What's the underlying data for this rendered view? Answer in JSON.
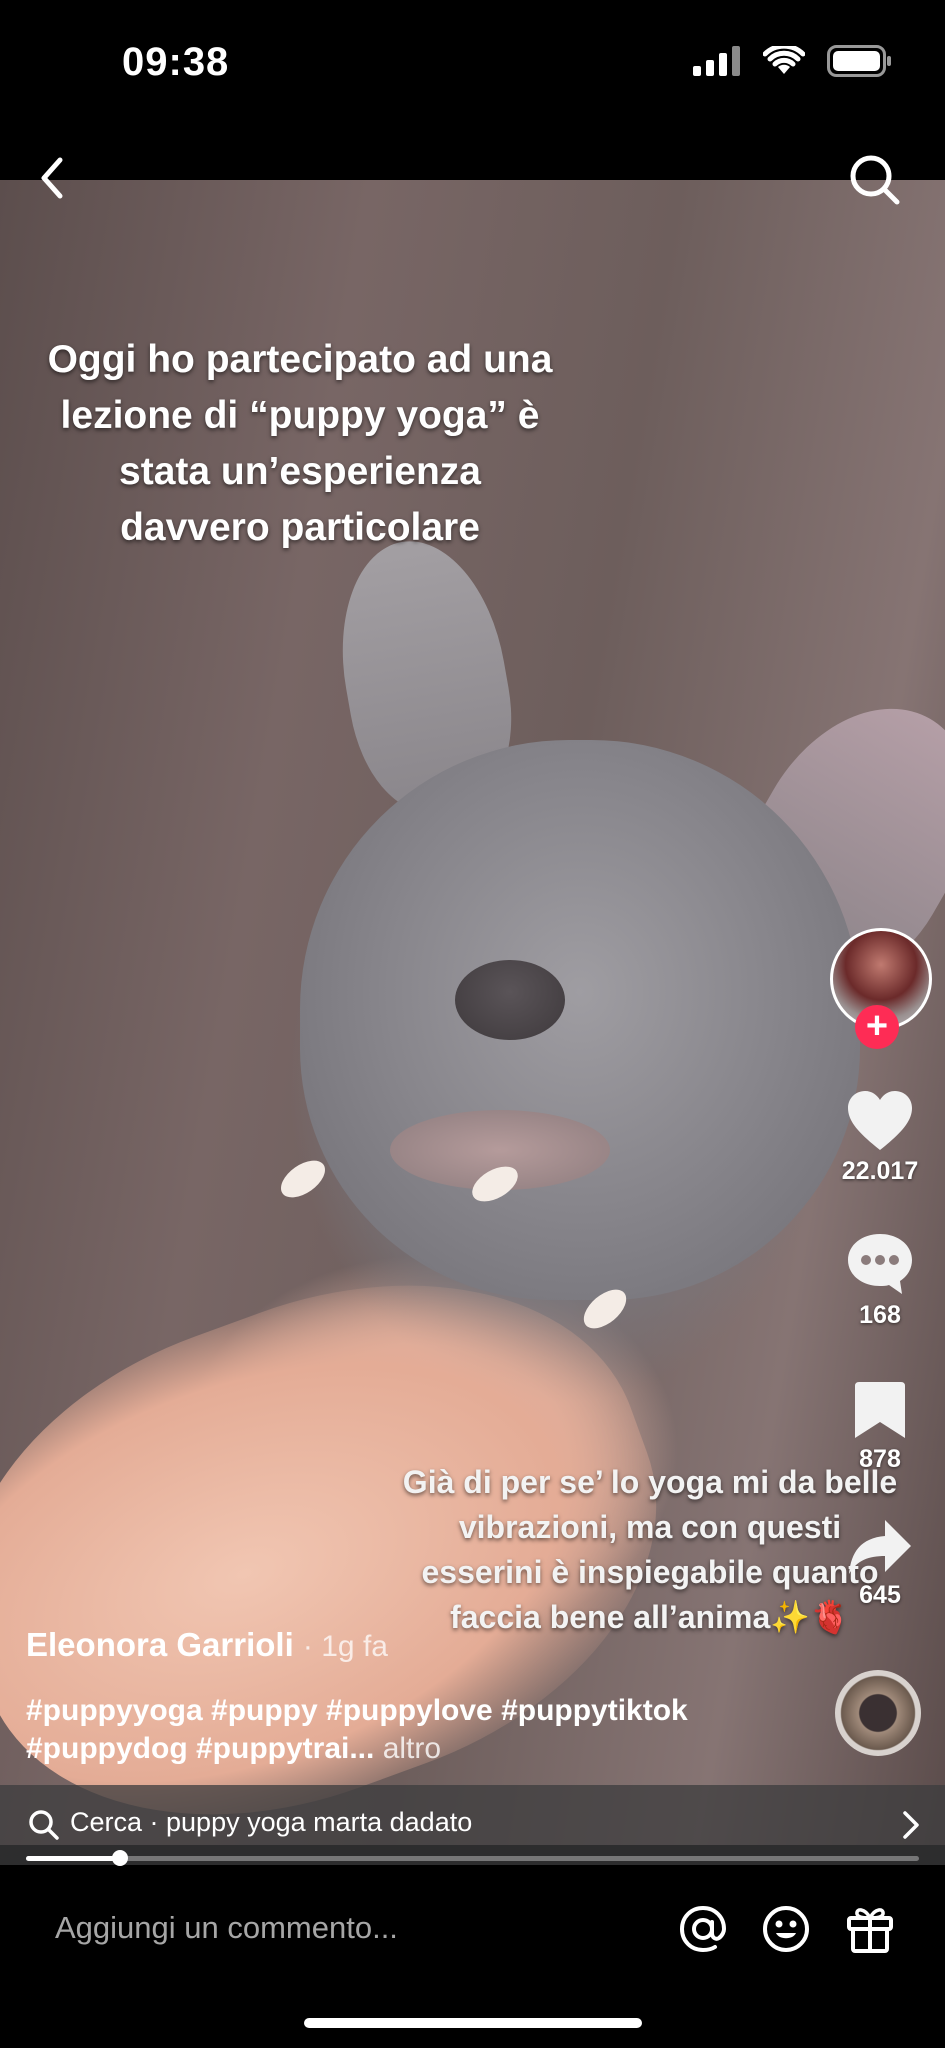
{
  "status": {
    "time": "09:38"
  },
  "video": {
    "caption_top": "Oggi ho partecipato ad una lezione di “puppy yoga” è stata un’esperienza davvero particolare",
    "caption_bottom": "Già di per se’ lo yoga mi da belle vibrazioni, ma con questi esserini è inspiegabile quanto faccia bene all’anima✨🫀",
    "progress": 0.105
  },
  "actions": {
    "likes": "22.017",
    "comments": "168",
    "saves": "878",
    "shares": "645"
  },
  "post": {
    "author": "Eleonora Garrioli",
    "time": "· 1g fa",
    "hashtags": "#puppyyoga #puppy #puppylove #puppytiktok #puppydog #puppytrai...",
    "more": "altro"
  },
  "search_suggestion": {
    "text": "Cerca · puppy yoga marta dadato"
  },
  "comment_bar": {
    "placeholder": "Aggiungi un commento..."
  },
  "colors": {
    "accent": "#fe2c55",
    "background": "#000000"
  },
  "icons": [
    "back-icon",
    "search-icon",
    "plus-icon",
    "heart-icon",
    "comment-icon",
    "bookmark-icon",
    "share-icon",
    "chevron-right-icon",
    "at-icon",
    "emoji-icon",
    "gift-icon"
  ]
}
